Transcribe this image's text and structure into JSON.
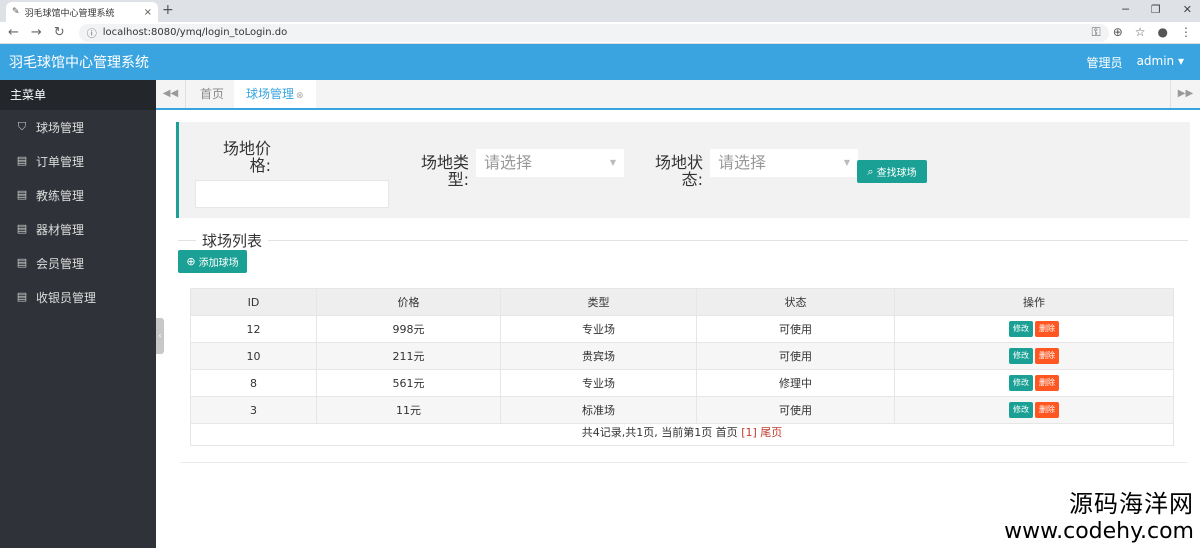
{
  "browser": {
    "tab_title": "羽毛球馆中心管理系统",
    "url": "localhost:8080/ymq/login_toLogin.do",
    "new_tab": "+",
    "close": "×"
  },
  "app": {
    "brand": "羽毛球馆中心管理系统",
    "role": "管理员",
    "user": "admin ▾"
  },
  "sidebar": {
    "header": "主菜单",
    "items": [
      {
        "label": "球场管理",
        "icon": "shopping-bag-icon"
      },
      {
        "label": "订单管理",
        "icon": "document-icon"
      },
      {
        "label": "教练管理",
        "icon": "document-icon"
      },
      {
        "label": "器材管理",
        "icon": "document-icon"
      },
      {
        "label": "会员管理",
        "icon": "document-icon"
      },
      {
        "label": "收银员管理",
        "icon": "document-icon"
      }
    ]
  },
  "content_tabs": {
    "home": "首页",
    "active": "球场管理"
  },
  "search": {
    "price_label_1": "场地价",
    "price_label_2": "格:",
    "type_label_1": "场地类",
    "type_label_2": "型:",
    "type_placeholder": "请选择",
    "status_label_1": "场地状",
    "status_label_2": "态:",
    "status_placeholder": "请选择",
    "search_button": "查找球场"
  },
  "list": {
    "legend": "球场列表",
    "add_button": "添加球场",
    "columns": [
      "ID",
      "价格",
      "类型",
      "状态",
      "操作"
    ],
    "rows": [
      {
        "id": "12",
        "price": "998元",
        "type": "专业场",
        "status": "可使用"
      },
      {
        "id": "10",
        "price": "211元",
        "type": "贵宾场",
        "status": "可使用"
      },
      {
        "id": "8",
        "price": "561元",
        "type": "专业场",
        "status": "修理中"
      },
      {
        "id": "3",
        "price": "11元",
        "type": "标准场",
        "status": "可使用"
      }
    ],
    "edit_label": "修改",
    "delete_label": "删除",
    "pager_text": "共4记录,共1页, 当前第1页 首页",
    "pager_current": "[1]",
    "pager_last": "尾页"
  },
  "watermark": {
    "line1": "源码海洋网",
    "line2": "www.codehy.com"
  }
}
